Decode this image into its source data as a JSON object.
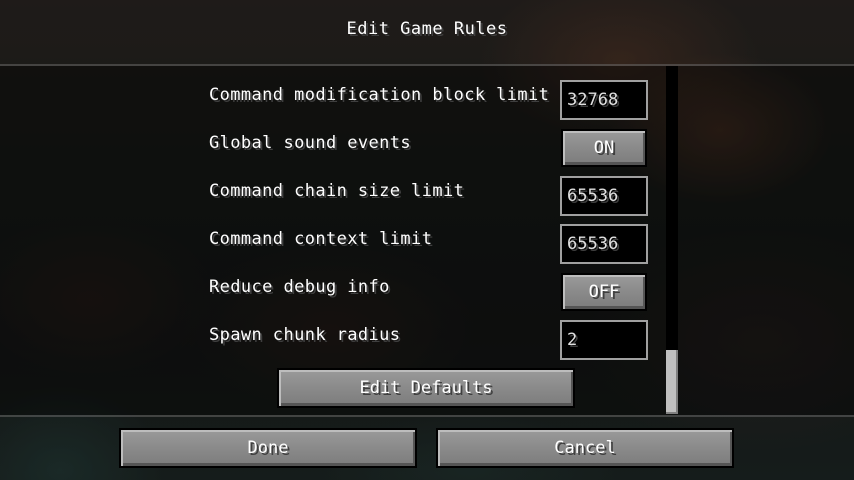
{
  "screen": {
    "title": "Edit Game Rules"
  },
  "rules": [
    {
      "label": "Command modification block limit",
      "control": "text",
      "value": "32768"
    },
    {
      "label": "Global sound events",
      "control": "toggle",
      "value": "ON"
    },
    {
      "label": "Command chain size limit",
      "control": "text",
      "value": "65536"
    },
    {
      "label": "Command context limit",
      "control": "text",
      "value": "65536"
    },
    {
      "label": "Reduce debug info",
      "control": "toggle",
      "value": "OFF"
    },
    {
      "label": "Spawn chunk radius",
      "control": "text",
      "value": "2"
    }
  ],
  "edit_defaults_label": "Edit Defaults",
  "footer": {
    "done_label": "Done",
    "cancel_label": "Cancel"
  },
  "scroll": {
    "position": 1.0
  }
}
